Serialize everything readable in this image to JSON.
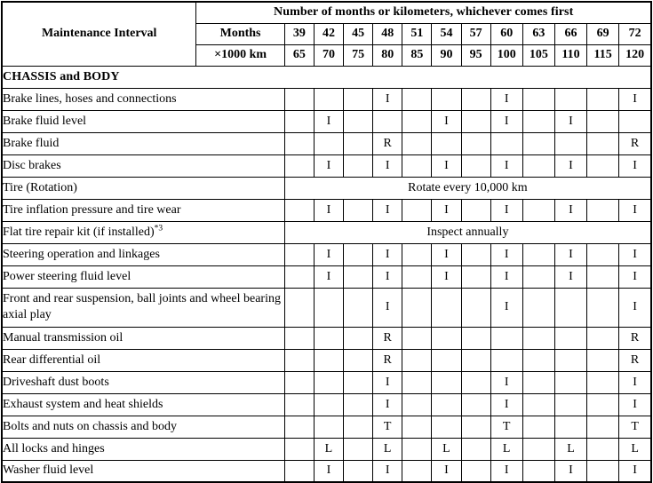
{
  "table": {
    "interval_header": "Maintenance Interval",
    "span_header": "Number of months or kilometers, whichever comes first",
    "unit_rows": [
      {
        "label": "Months",
        "values": [
          "39",
          "42",
          "45",
          "48",
          "51",
          "54",
          "57",
          "60",
          "63",
          "66",
          "69",
          "72"
        ]
      },
      {
        "label": "×1000 km",
        "values": [
          "65",
          "70",
          "75",
          "80",
          "85",
          "90",
          "95",
          "100",
          "105",
          "110",
          "115",
          "120"
        ]
      }
    ],
    "section_title": "CHASSIS and BODY",
    "rows": [
      {
        "label": "Brake lines, hoses and connections",
        "marks": [
          "",
          "",
          "",
          "I",
          "",
          "",
          "",
          "I",
          "",
          "",
          "",
          "I"
        ]
      },
      {
        "label": "Brake fluid level",
        "marks": [
          "",
          "I",
          "",
          "",
          "",
          "I",
          "",
          "I",
          "",
          "I",
          "",
          ""
        ]
      },
      {
        "label": "Brake fluid",
        "marks": [
          "",
          "",
          "",
          "R",
          "",
          "",
          "",
          "",
          "",
          "",
          "",
          "R"
        ]
      },
      {
        "label": "Disc brakes",
        "marks": [
          "",
          "I",
          "",
          "I",
          "",
          "I",
          "",
          "I",
          "",
          "I",
          "",
          "I"
        ]
      },
      {
        "label": "Tire (Rotation)",
        "note": "Rotate every 10,000 km"
      },
      {
        "label": "Tire inflation pressure and tire wear",
        "marks": [
          "",
          "I",
          "",
          "I",
          "",
          "I",
          "",
          "I",
          "",
          "I",
          "",
          "I"
        ]
      },
      {
        "label": "Flat tire repair kit (if installed)",
        "superscript": "*3",
        "note": "Inspect annually"
      },
      {
        "label": "Steering operation and linkages",
        "marks": [
          "",
          "I",
          "",
          "I",
          "",
          "I",
          "",
          "I",
          "",
          "I",
          "",
          "I"
        ]
      },
      {
        "label": "Power steering fluid level",
        "marks": [
          "",
          "I",
          "",
          "I",
          "",
          "I",
          "",
          "I",
          "",
          "I",
          "",
          "I"
        ]
      },
      {
        "label": "Front and rear suspension, ball joints and wheel bearing axial play",
        "tall": true,
        "marks": [
          "",
          "",
          "",
          "I",
          "",
          "",
          "",
          "I",
          "",
          "",
          "",
          "I"
        ]
      },
      {
        "label": "Manual transmission oil",
        "marks": [
          "",
          "",
          "",
          "R",
          "",
          "",
          "",
          "",
          "",
          "",
          "",
          "R"
        ]
      },
      {
        "label": "Rear differential oil",
        "marks": [
          "",
          "",
          "",
          "R",
          "",
          "",
          "",
          "",
          "",
          "",
          "",
          "R"
        ]
      },
      {
        "label": "Driveshaft dust boots",
        "marks": [
          "",
          "",
          "",
          "I",
          "",
          "",
          "",
          "I",
          "",
          "",
          "",
          "I"
        ]
      },
      {
        "label": "Exhaust system and heat shields",
        "marks": [
          "",
          "",
          "",
          "I",
          "",
          "",
          "",
          "I",
          "",
          "",
          "",
          "I"
        ]
      },
      {
        "label": "Bolts and nuts on chassis and body",
        "marks": [
          "",
          "",
          "",
          "T",
          "",
          "",
          "",
          "T",
          "",
          "",
          "",
          "T"
        ]
      },
      {
        "label": "All locks and hinges",
        "marks": [
          "",
          "L",
          "",
          "L",
          "",
          "L",
          "",
          "L",
          "",
          "L",
          "",
          "L"
        ]
      },
      {
        "label": "Washer fluid level",
        "marks": [
          "",
          "I",
          "",
          "I",
          "",
          "I",
          "",
          "I",
          "",
          "I",
          "",
          "I"
        ]
      }
    ]
  },
  "colors": {
    "header_background": "#e2e2e2",
    "border": "#000000",
    "text": "#000000",
    "cell_background": "#ffffff"
  }
}
